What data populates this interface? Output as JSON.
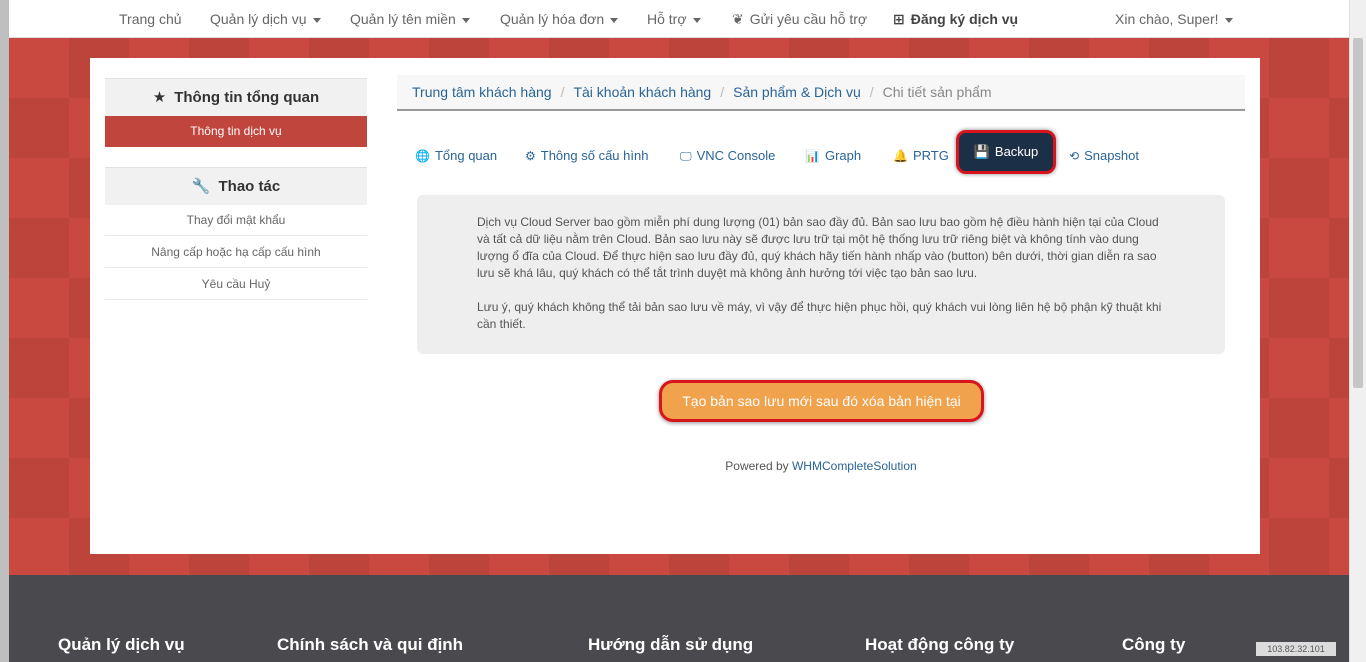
{
  "topnav": {
    "home": "Trang chủ",
    "services": "Quản lý dịch vụ",
    "domains": "Quản lý tên miền",
    "invoices": "Quản lý hóa đơn",
    "support": "Hỗ trợ",
    "ticket": "Gửi yêu cầu hỗ trợ",
    "register": "Đăng ký dịch vụ",
    "greeting": "Xin chào, Super!"
  },
  "sidebar": {
    "overview_title": "Thông tin tổng quan",
    "service_info": "Thông tin dịch vụ",
    "actions_title": "Thao tác",
    "actions": [
      "Thay đổi mật khẩu",
      "Nâng cấp hoặc hạ cấp cấu hình",
      "Yêu cầu Huỷ"
    ]
  },
  "breadcrumb": [
    "Trung tâm khách hàng",
    "Tài khoản khách hàng",
    "Sản phẩm & Dịch vụ",
    "Chi tiết sản phẩm"
  ],
  "tabs": [
    "Tổng quan",
    "Thông số cấu hình",
    "VNC Console",
    "Graph",
    "PRTG",
    "Backup",
    "Snapshot"
  ],
  "info": {
    "p1": "Dịch vụ Cloud Server bao gồm miễn phí dung lượng (01) bản sao đầy đủ. Bản sao lưu bao gồm hệ điều hành hiện tại của Cloud và tất cả dữ liệu nằm trên Cloud. Bản sao lưu này sẽ được lưu trữ tại một hệ thống lưu trữ riêng biệt và không tính vào dung lượng ổ đĩa của Cloud. Để thực hiện sao lưu đầy đủ, quý khách hãy tiến hành nhấp vào (button) bên dưới, thời gian diễn ra sao lưu sẽ khá lâu, quý khách có thể tắt trình duyệt mà không ảnh hưởng tới việc tạo bản sao lưu.",
    "p2": "Lưu ý, quý khách không thể tải bản sao lưu về máy, vì vậy để thực hiện phục hồi, quý khách vui lòng liên hệ bộ phận kỹ thuật khi cần thiết."
  },
  "cta_label": "Tạo bản sao lưu mới sau đó xóa bản hiện tại",
  "powered": {
    "prefix": "Powered by ",
    "link": "WHMCompleteSolution"
  },
  "footer": {
    "headings": [
      "Quản lý dịch vụ",
      "Chính sách và qui định",
      "Hướng dẫn sử dụng",
      "Hoạt động công ty",
      "Công ty"
    ],
    "ip": "103.82.32.101"
  },
  "colors": {
    "accent": "#c0453d",
    "active_tab": "#1b2f47",
    "cta": "#f0a24c",
    "highlight": "#d8141c"
  }
}
